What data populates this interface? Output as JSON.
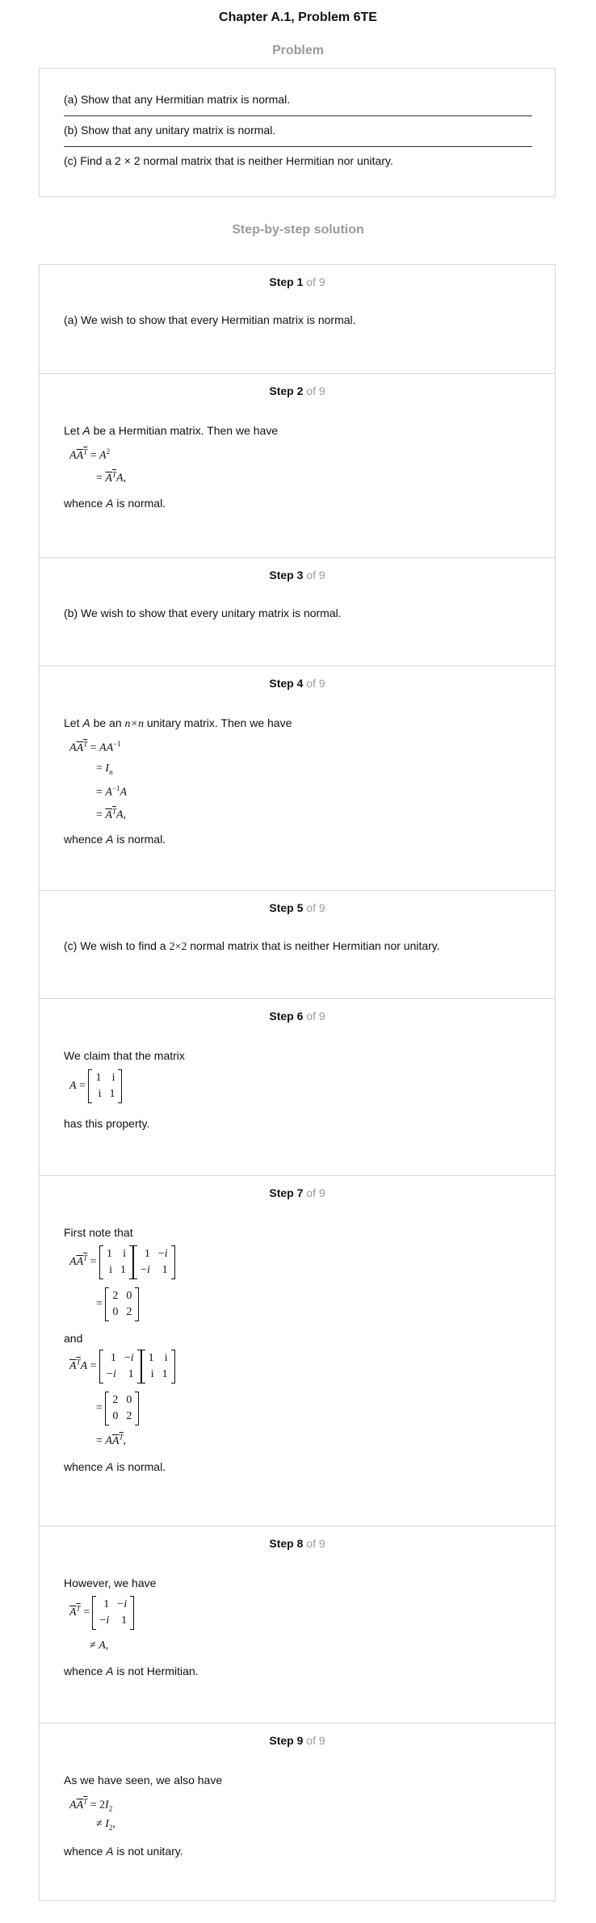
{
  "title": "Chapter A.1, Problem 6TE",
  "problem_heading": "Problem",
  "problem": {
    "a": "(a) Show that any Hermitian matrix is normal.",
    "b": "(b) Show that any unitary matrix is normal.",
    "c": "(c) Find a 2 × 2 normal matrix that is neither Hermitian nor unitary."
  },
  "solution_heading": "Step-by-step solution",
  "step_word": "Step",
  "of_total": "of 9",
  "steps": {
    "s1": {
      "num": "1",
      "text": "(a) We wish to show that every Hermitian matrix is normal."
    },
    "s2": {
      "num": "2",
      "intro_pre": "Let ",
      "intro_var": "A",
      "intro_post": " be a Hermitian matrix. Then we have",
      "whence_pre": "whence ",
      "whence_var": "A",
      "whence_post": " is normal."
    },
    "s3": {
      "num": "3",
      "text": "(b) We wish to show that every unitary matrix is normal."
    },
    "s4": {
      "num": "4",
      "intro_pre": "Let ",
      "intro_var": "A",
      "intro_mid": " be an ",
      "intro_dim": "n×n",
      "intro_post": " unitary matrix. Then we have",
      "whence_pre": "whence ",
      "whence_var": "A",
      "whence_post": " is normal."
    },
    "s5": {
      "num": "5",
      "text_pre": "(c) We wish to find a ",
      "text_dim": "2×2",
      "text_post": " normal matrix that is neither Hermitian nor unitary."
    },
    "s6": {
      "num": "6",
      "intro": "We claim that the matrix",
      "outro": "has this property."
    },
    "s7": {
      "num": "7",
      "intro": "First note that",
      "and": "and",
      "whence_pre": "whence ",
      "whence_var": "A",
      "whence_post": " is normal."
    },
    "s8": {
      "num": "8",
      "intro": "However, we have",
      "whence_pre": "whence ",
      "whence_var": "A",
      "whence_post": " is not Hermitian."
    },
    "s9": {
      "num": "9",
      "intro": "As we have seen, we also have",
      "whence_pre": "whence ",
      "whence_var": "A",
      "whence_post": " is not unitary."
    }
  }
}
